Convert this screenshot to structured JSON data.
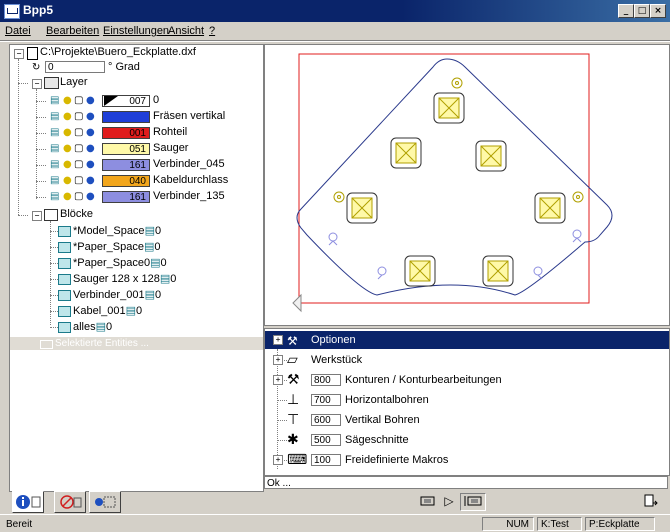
{
  "window": {
    "title": "Bpp5",
    "min": "_",
    "max": "□",
    "close": "×"
  },
  "menu": [
    "Datei",
    "Bearbeiten",
    "Einstellungen",
    "Ansicht",
    "?"
  ],
  "tree": {
    "file": "C:\\Projekte\\Buero_Eckplatte.dxf",
    "rotation_value": "0",
    "rotation_unit": "° Grad",
    "layers_label": "Layer",
    "layers": [
      {
        "code": "007",
        "name": "0",
        "color": "#ffffff"
      },
      {
        "code": "",
        "name": "Fräsen vertikal",
        "color": "#1f3fd8"
      },
      {
        "code": "001",
        "name": "Rohteil",
        "color": "#e01c1c"
      },
      {
        "code": "051",
        "name": "Sauger",
        "color": "#fff9a8"
      },
      {
        "code": "161",
        "name": "Verbinder_045",
        "color": "#8d8ee0"
      },
      {
        "code": "040",
        "name": "Kabeldurchlass",
        "color": "#f2a61c"
      },
      {
        "code": "161",
        "name": "Verbinder_135",
        "color": "#8d8ee0"
      }
    ],
    "blocks_label": "Blöcke",
    "blocks": [
      {
        "name": "*Model_Space",
        "count": "0"
      },
      {
        "name": "*Paper_Space",
        "count": "0"
      },
      {
        "name": "*Paper_Space0",
        "count": "0"
      },
      {
        "name": "Sauger 128 x 128",
        "count": "0"
      },
      {
        "name": "Verbinder_001",
        "count": "0"
      },
      {
        "name": "Kabel_001",
        "count": "0"
      },
      {
        "name": "alles",
        "count": "0"
      }
    ],
    "selected_entities": "Selektierte Entities ..."
  },
  "options": {
    "header": "Optionen",
    "items": [
      {
        "num": "",
        "label": "Werkstück"
      },
      {
        "num": "800",
        "label": "Konturen / Konturbearbeitungen"
      },
      {
        "num": "700",
        "label": "Horizontalbohren"
      },
      {
        "num": "600",
        "label": "Vertikal Bohren"
      },
      {
        "num": "500",
        "label": "Sägeschnitte"
      },
      {
        "num": "100",
        "label": "Freidefinierte Makros"
      }
    ]
  },
  "ok_text": "Ok ...",
  "status": {
    "left": "Bereit",
    "num": "NUM",
    "k": "K:Test",
    "p": "P:Eckplatte"
  },
  "colors": {
    "titlebar": "#0a246a",
    "selection": "#0a246a",
    "rohteil": "#e01c1c",
    "contour": "#2b3a8c",
    "sauger": "#fff9a8"
  }
}
